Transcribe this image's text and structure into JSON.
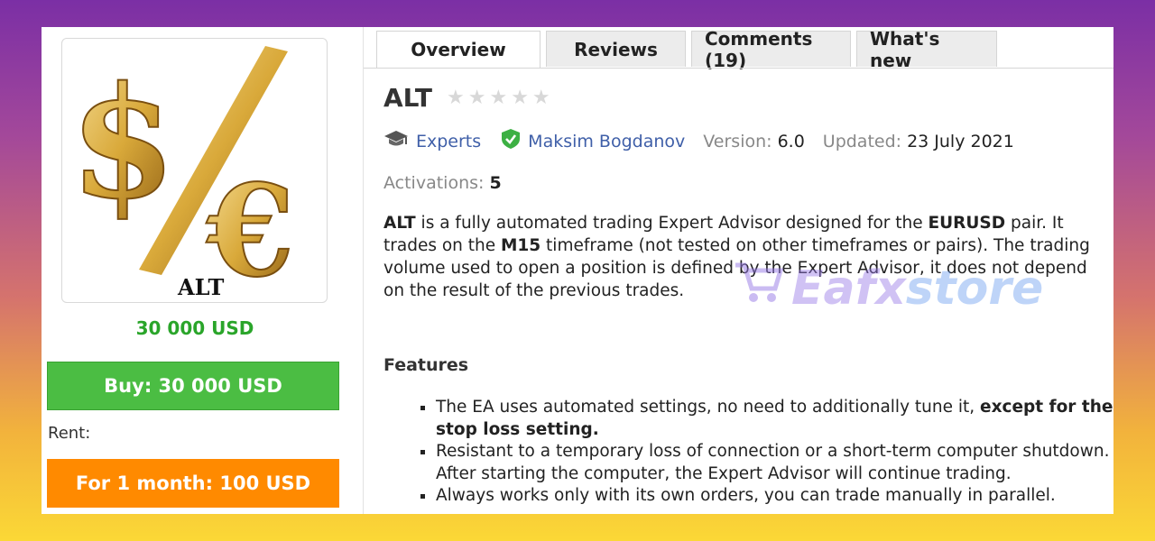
{
  "product": {
    "price": "30 000 USD",
    "logo_text": "ALT",
    "buy_label": "Buy: 30 000 USD",
    "rent_label": "Rent:",
    "rent_option": "For 1 month: 100 USD"
  },
  "tabs": [
    {
      "label": "Overview",
      "active": true
    },
    {
      "label": "Reviews",
      "active": false
    },
    {
      "label": "Comments (19)",
      "active": false
    },
    {
      "label": "What's new",
      "active": false
    }
  ],
  "header": {
    "title": "ALT",
    "rating": 0,
    "category": "Experts",
    "author": "Maksim Bogdanov",
    "version_label": "Version:",
    "version": "6.0",
    "updated_label": "Updated:",
    "updated": "23 July 2021",
    "activations_label": "Activations:",
    "activations": "5"
  },
  "description": {
    "p1": "ALT",
    "p2": " is a fully automated trading Expert Advisor designed for the ",
    "p3": "EURUSD",
    "p4": " pair. It trades on the ",
    "p5": "M15",
    "p6": " timeframe (not tested on other timeframes or pairs). The trading volume used to open a position is defined by the Expert Advisor, it does not depend on the result of the previous trades."
  },
  "features": {
    "heading": "Features",
    "items": [
      {
        "text": "The EA uses automated settings, no need to additionally tune it, ",
        "bold": "except for the stop loss setting."
      },
      {
        "text": "Resistant to a temporary loss of connection or a short-term computer shutdown. After starting the computer, the Expert Advisor will continue trading.",
        "bold": ""
      },
      {
        "text": "Always works only with its own orders, you can trade manually in parallel.",
        "bold": ""
      }
    ]
  },
  "watermark": {
    "part1": "Ea",
    "part2": "fx",
    "part3": "store"
  },
  "colors": {
    "price_green": "#2aa52a",
    "buy_green": "#4bbd43",
    "rent_orange": "#ff8a00",
    "link_blue": "#3f5fa8"
  }
}
